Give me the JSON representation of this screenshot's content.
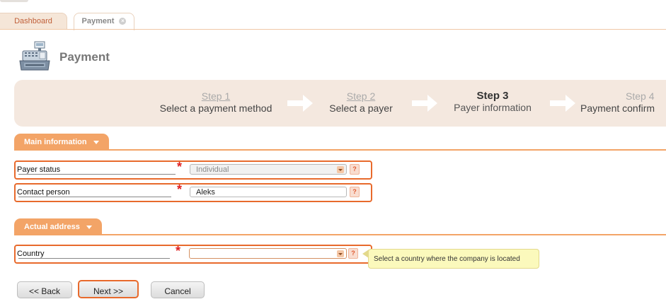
{
  "tabs": [
    {
      "label": "Dashboard"
    },
    {
      "label": "Payment"
    }
  ],
  "page": {
    "title": "Payment"
  },
  "wizard": {
    "steps": [
      {
        "number": "Step 1",
        "label": "Select a payment method"
      },
      {
        "number": "Step 2",
        "label": "Select a payer"
      },
      {
        "number": "Step 3",
        "label": "Payer information"
      },
      {
        "number": "Step 4",
        "label": "Payment confirm"
      }
    ],
    "current_step": 3
  },
  "sections": {
    "main": {
      "label": "Main information"
    },
    "address": {
      "label": "Actual address"
    }
  },
  "fields": {
    "payer_status": {
      "label": "Payer status",
      "value": "Individual",
      "help": "?"
    },
    "contact_person": {
      "label": "Contact person",
      "value": "Aleks",
      "help": "?"
    },
    "country": {
      "label": "Country",
      "value": "",
      "help": "?"
    }
  },
  "tooltip": {
    "text": "Select a country where the company is located"
  },
  "buttons": {
    "back": "<< Back",
    "next": "Next >>",
    "cancel": "Cancel"
  },
  "required_mark": "*",
  "colors": {
    "accent": "#f3a467",
    "highlight": "#e86a2c",
    "wizard_bg": "#f4e8df",
    "required": "#e02020"
  }
}
